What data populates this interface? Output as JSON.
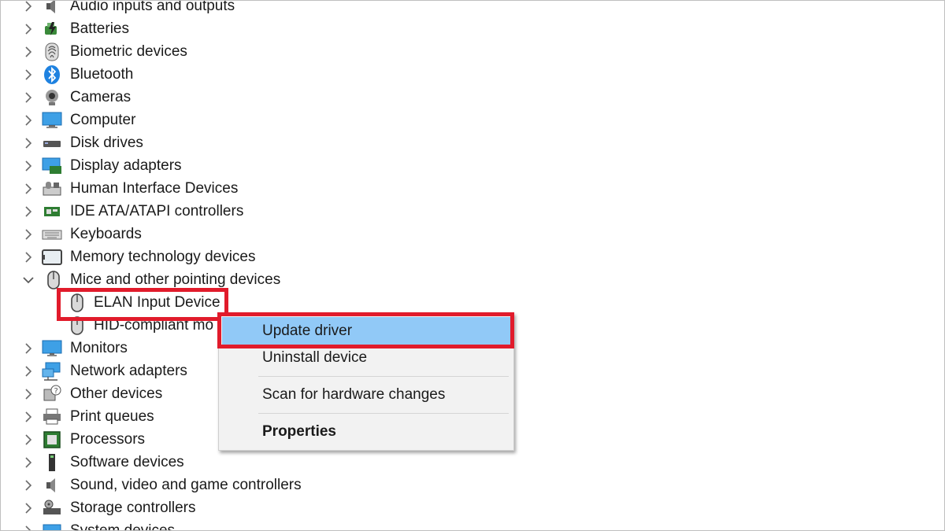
{
  "tree": {
    "categories_top": [
      {
        "label": "Audio inputs and outputs",
        "icon": "speaker-icon"
      },
      {
        "label": "Batteries",
        "icon": "battery-icon"
      },
      {
        "label": "Biometric devices",
        "icon": "fingerprint-icon"
      },
      {
        "label": "Bluetooth",
        "icon": "bluetooth-icon"
      },
      {
        "label": "Cameras",
        "icon": "camera-icon"
      },
      {
        "label": "Computer",
        "icon": "computer-icon"
      },
      {
        "label": "Disk drives",
        "icon": "disk-drive-icon"
      },
      {
        "label": "Display adapters",
        "icon": "display-adapter-icon"
      },
      {
        "label": "Human Interface Devices",
        "icon": "hid-icon"
      },
      {
        "label": "IDE ATA/ATAPI controllers",
        "icon": "ide-controller-icon"
      },
      {
        "label": "Keyboards",
        "icon": "keyboard-icon"
      },
      {
        "label": "Memory technology devices",
        "icon": "memory-icon"
      }
    ],
    "expanded_category": {
      "label": "Mice and other pointing devices",
      "icon": "mouse-icon"
    },
    "children": [
      {
        "label": "ELAN Input Device",
        "icon": "mouse-icon",
        "selected": true
      },
      {
        "label": "HID-compliant mouse",
        "visible_label": "HID-compliant mo",
        "icon": "mouse-icon"
      }
    ],
    "categories_bottom": [
      {
        "label": "Monitors",
        "icon": "monitor-icon"
      },
      {
        "label": "Network adapters",
        "icon": "network-icon"
      },
      {
        "label": "Other devices",
        "icon": "unknown-device-icon"
      },
      {
        "label": "Print queues",
        "icon": "printer-icon"
      },
      {
        "label": "Processors",
        "icon": "processor-icon"
      },
      {
        "label": "Software devices",
        "icon": "software-device-icon"
      },
      {
        "label": "Sound, video and game controllers",
        "icon": "sound-icon"
      },
      {
        "label": "Storage controllers",
        "icon": "storage-controller-icon"
      },
      {
        "label": "System devices",
        "icon": "system-device-icon"
      }
    ]
  },
  "context_menu": {
    "items": [
      {
        "label": "Update driver",
        "highlighted": true
      },
      {
        "label": "Uninstall device"
      },
      {
        "label": "Scan for hardware changes"
      },
      {
        "label": "Properties",
        "bold": true
      }
    ]
  },
  "colors": {
    "annotation_red": "#e11b2b",
    "menu_highlight": "#91c9f7",
    "menu_background": "#f2f2f2"
  }
}
